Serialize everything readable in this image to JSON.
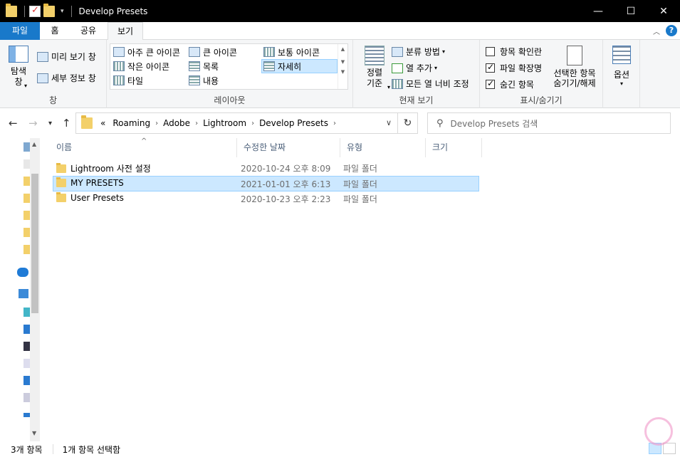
{
  "window": {
    "title": "Develop Presets",
    "controls": {
      "minimize": "—",
      "maximize": "☐",
      "close": "✕"
    }
  },
  "ribbon_tabs": [
    {
      "label": "파일"
    },
    {
      "label": "홈"
    },
    {
      "label": "공유"
    },
    {
      "label": "보기"
    }
  ],
  "ribbon": {
    "pane_group": {
      "label": "창",
      "nav_pane": "탐색\n창",
      "preview_pane": "미리 보기 창",
      "details_pane": "세부 정보 창"
    },
    "layout_group": {
      "label": "레이아웃",
      "items": [
        "아주 큰 아이콘",
        "큰 아이콘",
        "보통 아이콘",
        "작은 아이콘",
        "목록",
        "자세히",
        "타일",
        "내용"
      ],
      "selected": "자세히"
    },
    "current_view_group": {
      "label": "현재 보기",
      "sort_by": "정렬\n기준",
      "group_by": "분류 방법",
      "add_columns": "열 추가",
      "size_all_columns": "모든 열 너비 조정"
    },
    "show_hide_group": {
      "label": "표시/숨기기",
      "item_checkboxes": {
        "label": "항목 확인란",
        "checked": false
      },
      "file_extensions": {
        "label": "파일 확장명",
        "checked": true
      },
      "hidden_items": {
        "label": "숨긴 항목",
        "checked": true
      },
      "hide_selected": "선택한 항목\n숨기기/해제"
    },
    "options": {
      "label": "옵션"
    }
  },
  "address_bar": {
    "overflow": "«",
    "crumbs": [
      "Roaming",
      "Adobe",
      "Lightroom",
      "Develop Presets"
    ]
  },
  "search": {
    "placeholder": "Develop Presets 검색"
  },
  "columns": [
    "이름",
    "수정한 날짜",
    "유형",
    "크기"
  ],
  "files": [
    {
      "name": "Lightroom 사전 설정",
      "date": "2020-10-24 오후 8:09",
      "type": "파일 폴더",
      "selected": false
    },
    {
      "name": "MY PRESETS",
      "date": "2021-01-01 오후 6:13",
      "type": "파일 폴더",
      "selected": true
    },
    {
      "name": "User Presets",
      "date": "2020-10-23 오후 2:23",
      "type": "파일 폴더",
      "selected": false
    }
  ],
  "status": {
    "item_count": "3개 항목",
    "selected_count": "1개 항목 선택함"
  },
  "colors": {
    "accent": "#1979ca",
    "selection": "#cce8ff",
    "selection_border": "#99d1ff"
  }
}
